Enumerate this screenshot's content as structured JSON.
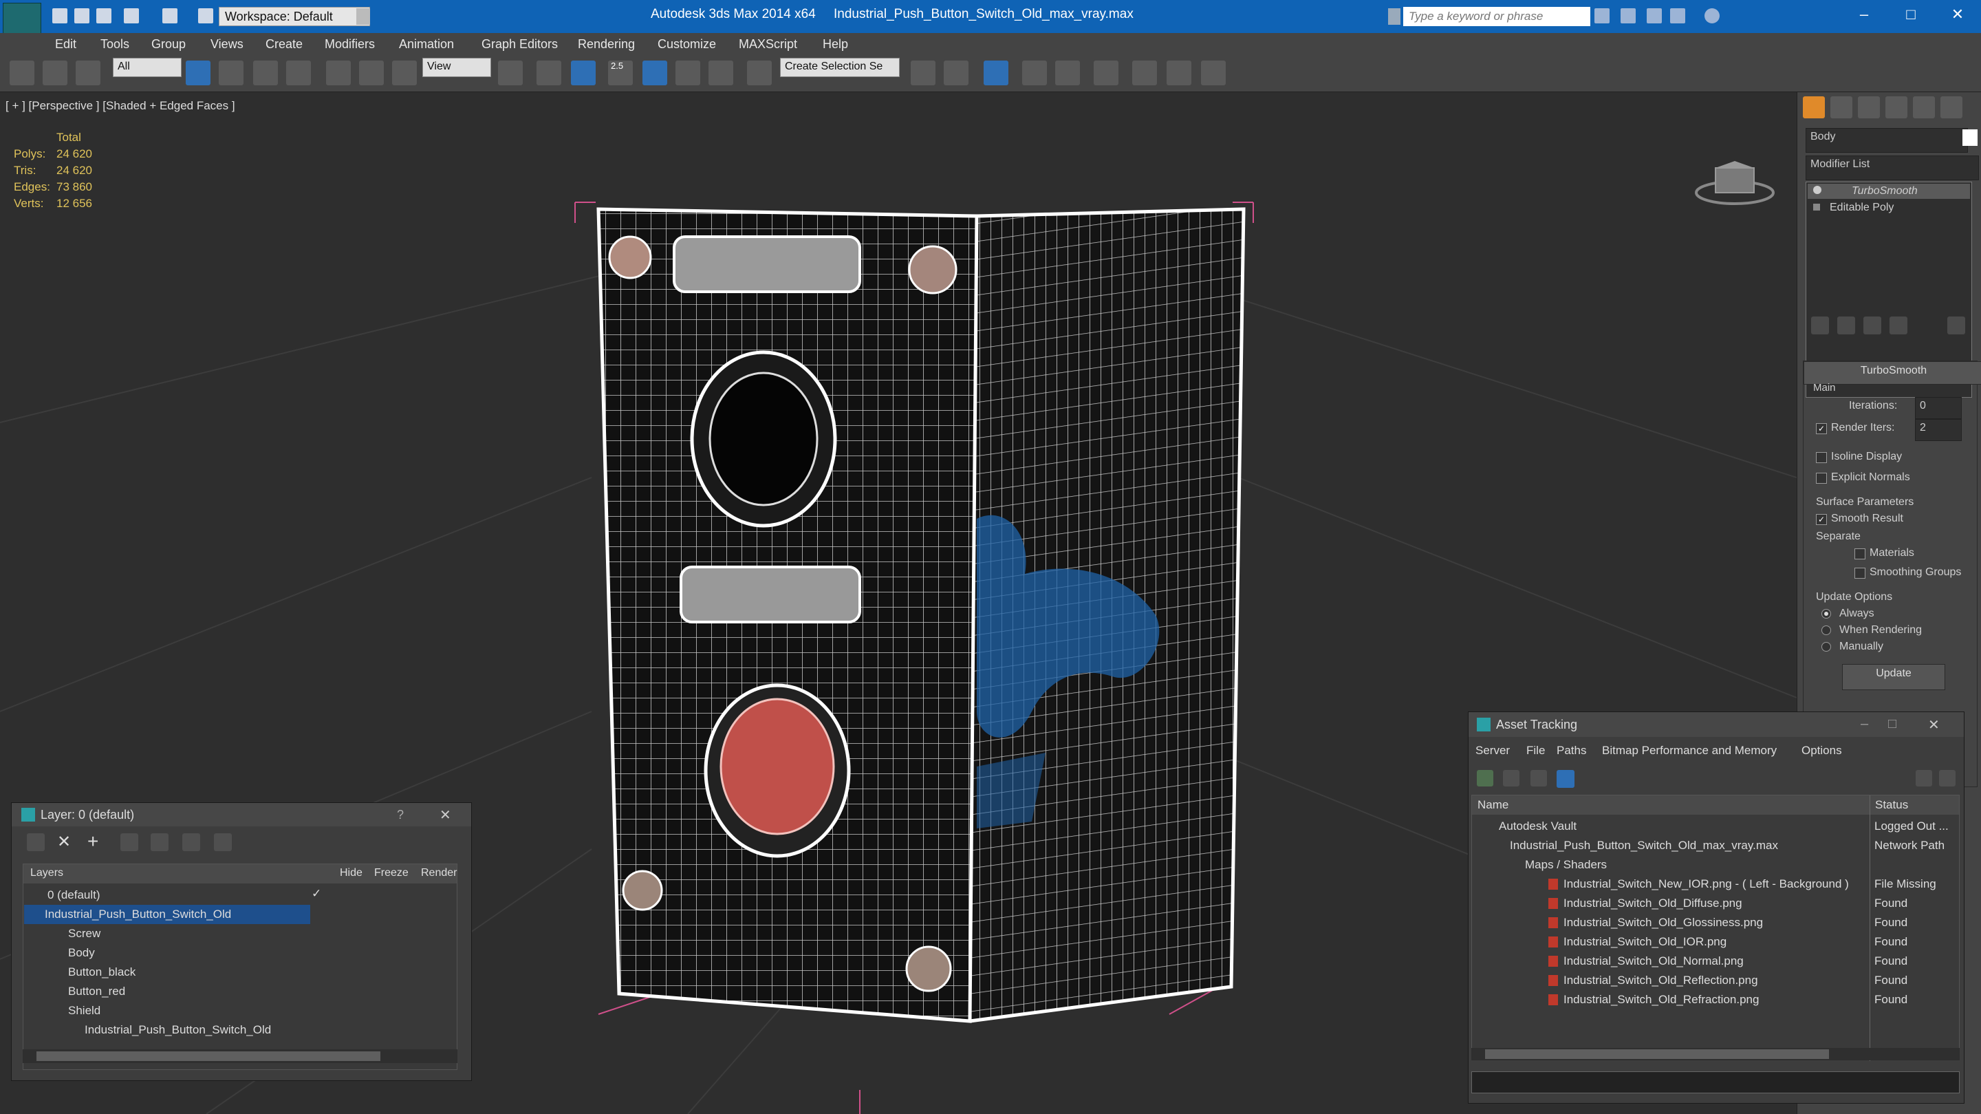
{
  "app": {
    "title_left": "Autodesk 3ds Max  2014 x64",
    "title_file": "Industrial_Push_Button_Switch_Old_max_vray.max",
    "workspace": "Workspace: Default",
    "search_placeholder": "Type a keyword or phrase"
  },
  "menu": [
    "Edit",
    "Tools",
    "Group",
    "Views",
    "Create",
    "Modifiers",
    "Animation",
    "Graph Editors",
    "Rendering",
    "Customize",
    "MAXScript",
    "Help"
  ],
  "toolbar": {
    "filter": "All",
    "ref_coord": "View",
    "sel_set": "Create Selection Se",
    "snap_value": "2.5"
  },
  "viewport": {
    "label": "[ + ] [Perspective ] [Shaded + Edged Faces ]",
    "stats_header": "Total",
    "stats": [
      {
        "k": "Polys:",
        "v": "24 620"
      },
      {
        "k": "Tris:",
        "v": "24 620"
      },
      {
        "k": "Edges:",
        "v": "73 860"
      },
      {
        "k": "Verts:",
        "v": "12 656"
      }
    ]
  },
  "command_panel": {
    "object_name": "Body",
    "modifier_list": "Modifier List",
    "stack": [
      "TurboSmooth",
      "Editable Poly"
    ],
    "rollout": "TurboSmooth",
    "main": "Main",
    "iterations_label": "Iterations:",
    "iterations": "0",
    "render_iters_label": "Render Iters:",
    "render_iters": "2",
    "isoline": "Isoline Display",
    "explicit": "Explicit Normals",
    "surface_params": "Surface Parameters",
    "smooth_result": "Smooth Result",
    "separate": "Separate",
    "materials": "Materials",
    "smoothing_groups": "Smoothing Groups",
    "update_options": "Update Options",
    "always": "Always",
    "when_rendering": "When Rendering",
    "manually": "Manually",
    "update_btn": "Update"
  },
  "layer_window": {
    "title": "Layer: 0 (default)",
    "help": "?",
    "columns": {
      "layers": "Layers",
      "hide": "Hide",
      "freeze": "Freeze",
      "render": "Render"
    },
    "rows": [
      {
        "name": "0 (default)",
        "indent": 0
      },
      {
        "name": "Industrial_Push_Button_Switch_Old",
        "indent": 0
      },
      {
        "name": "Screw",
        "indent": 1
      },
      {
        "name": "Body",
        "indent": 1
      },
      {
        "name": "Button_black",
        "indent": 1
      },
      {
        "name": "Button_red",
        "indent": 1
      },
      {
        "name": "Shield",
        "indent": 1
      },
      {
        "name": "Industrial_Push_Button_Switch_Old",
        "indent": 1
      }
    ]
  },
  "asset_window": {
    "title": "Asset Tracking",
    "menu": [
      "Server",
      "File",
      "Paths",
      "Bitmap Performance and Memory",
      "Options"
    ],
    "col_name": "Name",
    "col_status": "Status",
    "rows": [
      {
        "name": "Autodesk Vault",
        "status": "Logged Out ...",
        "indent": 1
      },
      {
        "name": "Industrial_Push_Button_Switch_Old_max_vray.max",
        "status": "Network Path",
        "indent": 2
      },
      {
        "name": "Maps / Shaders",
        "status": "",
        "indent": 3
      },
      {
        "name": "Industrial_Switch_New_IOR.png -  ( Left - Background )",
        "status": "File Missing",
        "indent": 4
      },
      {
        "name": "Industrial_Switch_Old_Diffuse.png",
        "status": "Found",
        "indent": 4
      },
      {
        "name": "Industrial_Switch_Old_Glossiness.png",
        "status": "Found",
        "indent": 4
      },
      {
        "name": "Industrial_Switch_Old_IOR.png",
        "status": "Found",
        "indent": 4
      },
      {
        "name": "Industrial_Switch_Old_Normal.png",
        "status": "Found",
        "indent": 4
      },
      {
        "name": "Industrial_Switch_Old_Reflection.png",
        "status": "Found",
        "indent": 4
      },
      {
        "name": "Industrial_Switch_Old_Refraction.png",
        "status": "Found",
        "indent": 4
      }
    ]
  },
  "colors": {
    "title_bar": "#0f63b5",
    "selection": "#1e4f8c",
    "stats": "#e0c35a",
    "red_button": "#c0504a",
    "paint": "#1f63a8"
  }
}
